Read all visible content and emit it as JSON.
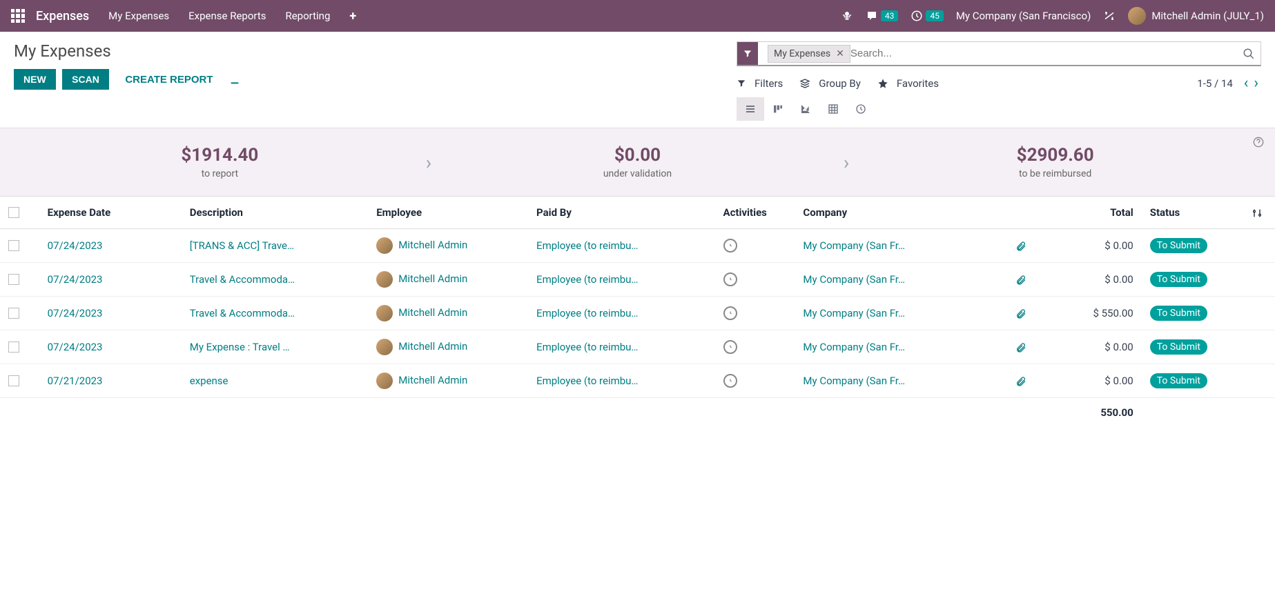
{
  "nav": {
    "brand": "Expenses",
    "items": [
      "My Expenses",
      "Expense Reports",
      "Reporting"
    ],
    "chat_badge": "43",
    "clock_badge": "45",
    "company": "My Company (San Francisco)",
    "user": "Mitchell Admin (JULY_1)"
  },
  "page": {
    "title": "My Expenses",
    "new_btn": "NEW",
    "scan_btn": "SCAN",
    "create_report": "CREATE REPORT"
  },
  "search": {
    "tag_label": "My Expenses",
    "placeholder": "Search..."
  },
  "filters": {
    "filters": "Filters",
    "groupby": "Group By",
    "favorites": "Favorites",
    "pager": "1-5 / 14"
  },
  "dashboard": {
    "to_report_amount": "$1914.40",
    "to_report_label": "to report",
    "under_validation_amount": "$0.00",
    "under_validation_label": "under validation",
    "to_reimburse_amount": "$2909.60",
    "to_reimburse_label": "to be reimbursed"
  },
  "table": {
    "headers": {
      "date": "Expense Date",
      "description": "Description",
      "employee": "Employee",
      "paidby": "Paid By",
      "activities": "Activities",
      "company": "Company",
      "total": "Total",
      "status": "Status"
    },
    "rows": [
      {
        "date": "07/24/2023",
        "desc": "[TRANS & ACC] Trave…",
        "employee": "Mitchell Admin",
        "paidby": "Employee (to reimbu…",
        "company": "My Company (San Fr…",
        "total": "$ 0.00",
        "status": "To Submit"
      },
      {
        "date": "07/24/2023",
        "desc": "Travel & Accommoda…",
        "employee": "Mitchell Admin",
        "paidby": "Employee (to reimbu…",
        "company": "My Company (San Fr…",
        "total": "$ 0.00",
        "status": "To Submit"
      },
      {
        "date": "07/24/2023",
        "desc": "Travel & Accommoda…",
        "employee": "Mitchell Admin",
        "paidby": "Employee (to reimbu…",
        "company": "My Company (San Fr…",
        "total": "$ 550.00",
        "status": "To Submit"
      },
      {
        "date": "07/24/2023",
        "desc": "My Expense : Travel …",
        "employee": "Mitchell Admin",
        "paidby": "Employee (to reimbu…",
        "company": "My Company (San Fr…",
        "total": "$ 0.00",
        "status": "To Submit"
      },
      {
        "date": "07/21/2023",
        "desc": "expense",
        "employee": "Mitchell Admin",
        "paidby": "Employee (to reimbu…",
        "company": "My Company (San Fr…",
        "total": "$ 0.00",
        "status": "To Submit"
      }
    ],
    "footer_total": "550.00"
  }
}
